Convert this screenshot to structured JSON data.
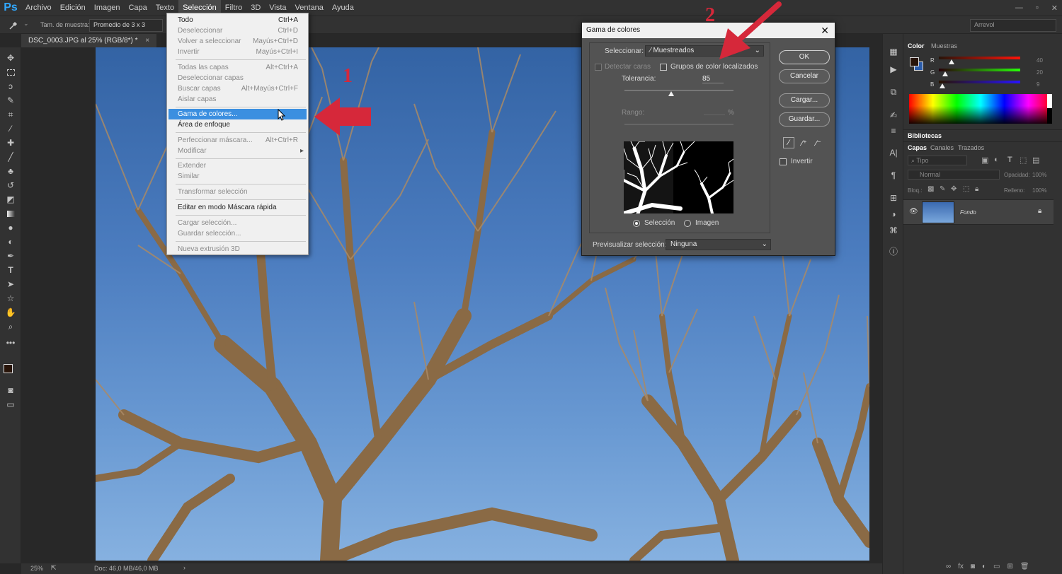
{
  "app": {
    "logo": "Ps",
    "menu": [
      "Archivo",
      "Edición",
      "Imagen",
      "Capa",
      "Texto",
      "Selección",
      "Filtro",
      "3D",
      "Vista",
      "Ventana",
      "Ayuda"
    ],
    "active_menu": "Selección",
    "window_controls": [
      "—",
      "▫",
      "✕"
    ]
  },
  "options": {
    "sample_label": "Tam. de muestra:",
    "sample_value": "Promedio de 3 x 3",
    "workspace": "Arrevol"
  },
  "document": {
    "tab_title": "DSC_0003.JPG al 25% (RGB/8*) *",
    "tab_close": "×"
  },
  "status": {
    "zoom": "25%",
    "doc": "Doc: 46,0 MB/46,0 MB",
    "arrow": "›"
  },
  "selection_menu": {
    "items": [
      {
        "label": "Todo",
        "shortcut": "Ctrl+A",
        "enabled": true
      },
      {
        "label": "Deseleccionar",
        "shortcut": "Ctrl+D",
        "enabled": false
      },
      {
        "label": "Volver a seleccionar",
        "shortcut": "Mayús+Ctrl+D",
        "enabled": false
      },
      {
        "label": "Invertir",
        "shortcut": "Mayús+Ctrl+I",
        "enabled": false
      },
      {
        "label": "Todas las capas",
        "shortcut": "Alt+Ctrl+A",
        "enabled": false
      },
      {
        "label": "Deseleccionar capas",
        "shortcut": "",
        "enabled": false
      },
      {
        "label": "Buscar capas",
        "shortcut": "Alt+Mayús+Ctrl+F",
        "enabled": false
      },
      {
        "label": "Aislar capas",
        "shortcut": "",
        "enabled": false
      },
      {
        "label": "Gama de colores...",
        "shortcut": "",
        "enabled": true,
        "highlighted": true
      },
      {
        "label": "Área de enfoque",
        "shortcut": "",
        "enabled": true
      },
      {
        "label": "Perfeccionar máscara...",
        "shortcut": "Alt+Ctrl+R",
        "enabled": false
      },
      {
        "label": "Modificar",
        "shortcut": "▸",
        "enabled": false
      },
      {
        "label": "Extender",
        "shortcut": "",
        "enabled": false
      },
      {
        "label": "Similar",
        "shortcut": "",
        "enabled": false
      },
      {
        "label": "Transformar selección",
        "shortcut": "",
        "enabled": false
      },
      {
        "label": "Editar en modo Máscara rápida",
        "shortcut": "",
        "enabled": true
      },
      {
        "label": "Cargar selección...",
        "shortcut": "",
        "enabled": false
      },
      {
        "label": "Guardar selección...",
        "shortcut": "",
        "enabled": false
      },
      {
        "label": "Nueva extrusión 3D",
        "shortcut": "",
        "enabled": false
      }
    ]
  },
  "dialog": {
    "title": "Gama de colores",
    "close": "✕",
    "select_label": "Seleccionar:",
    "select_value": "Muestreados",
    "detect_faces": "Detectar caras",
    "localized_groups": "Grupos de color localizados",
    "tolerance_label": "Tolerancia:",
    "tolerance_value": "85",
    "tolerance_fraction": 0.43,
    "range_label": "Rango:",
    "range_unit": "%",
    "radio_selection": "Selección",
    "radio_image": "Imagen",
    "preview_label": "Previsualizar selección:",
    "preview_value": "Ninguna",
    "buttons": {
      "ok": "OK",
      "cancel": "Cancelar",
      "load": "Cargar...",
      "save": "Guardar..."
    },
    "invert": "Invertir"
  },
  "color_panel": {
    "tabs": [
      "Color",
      "Muestras"
    ],
    "channels": [
      {
        "name": "R",
        "value": "40",
        "fraction": 0.16
      },
      {
        "name": "G",
        "value": "20",
        "fraction": 0.08
      },
      {
        "name": "B",
        "value": "9",
        "fraction": 0.04
      }
    ],
    "foreground": "#281409"
  },
  "libraries": {
    "title": "Bibliotecas"
  },
  "layers_panel": {
    "tabs": [
      "Capas",
      "Canales",
      "Trazados"
    ],
    "filter": "Tipo",
    "blend_mode": "Normal",
    "opacity_label": "Opacidad:",
    "opacity_value": "100%",
    "lock_label": "Bloq.:",
    "fill_label": "Relleno:",
    "fill_value": "100%",
    "layer_name": "Fondo"
  },
  "annotations": {
    "step1": "1",
    "step2": "2"
  },
  "colors": {
    "accent": "#3b8fe0",
    "arrow": "#d6283a",
    "sky_top": "#3363a4",
    "sky_bottom": "#86b1e0"
  }
}
